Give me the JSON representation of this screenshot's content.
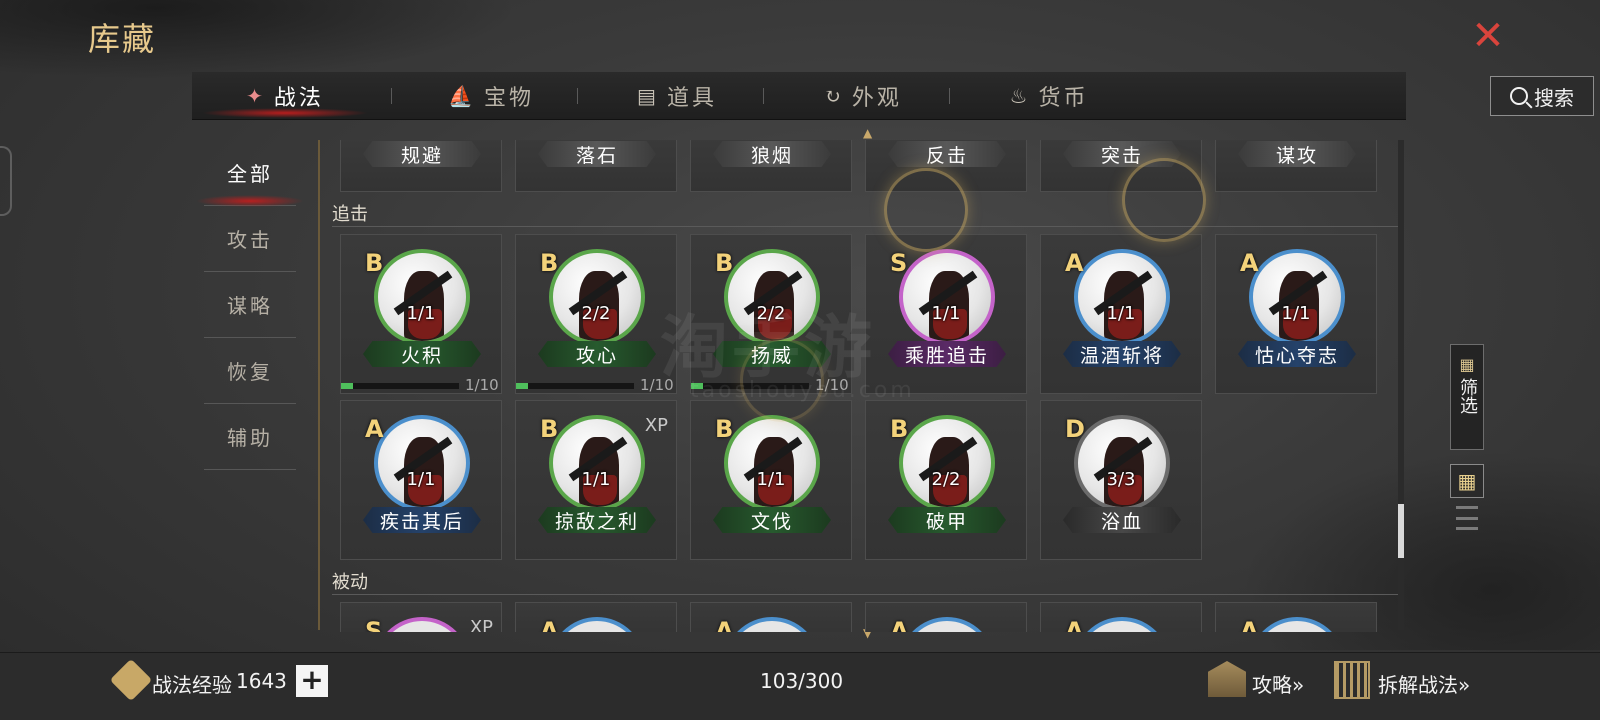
{
  "page_title": "库藏",
  "tabs": [
    {
      "label": "战法",
      "icon": "scroll-bundle-icon",
      "active": true
    },
    {
      "label": "宝物",
      "icon": "treasure-icon",
      "active": false
    },
    {
      "label": "道具",
      "icon": "items-icon",
      "active": false
    },
    {
      "label": "外观",
      "icon": "appearance-icon",
      "active": false
    },
    {
      "label": "货币",
      "icon": "money-bag-icon",
      "active": false
    }
  ],
  "search": {
    "label": "搜索"
  },
  "sidebar": {
    "items": [
      {
        "label": "全部",
        "active": true
      },
      {
        "label": "攻击",
        "active": false
      },
      {
        "label": "谋略",
        "active": false
      },
      {
        "label": "恢复",
        "active": false
      },
      {
        "label": "辅助",
        "active": false
      }
    ]
  },
  "top_row": [
    {
      "name": "规避"
    },
    {
      "name": "落石"
    },
    {
      "name": "狼烟"
    },
    {
      "name": "反击"
    },
    {
      "name": "突击"
    },
    {
      "name": "谋攻"
    }
  ],
  "sections": {
    "pursuit": {
      "title": "追击"
    },
    "passive": {
      "title": "被动"
    }
  },
  "pursuit_cards": [
    {
      "grade": "B",
      "count": "1/1",
      "name": "火积",
      "color": "g",
      "progress": "1/10",
      "progress_value": 0.1
    },
    {
      "grade": "B",
      "count": "2/2",
      "name": "攻心",
      "color": "g",
      "progress": "1/10",
      "progress_value": 0.1
    },
    {
      "grade": "B",
      "count": "2/2",
      "name": "扬威",
      "color": "g",
      "progress": "1/10",
      "progress_value": 0.1
    },
    {
      "grade": "S",
      "count": "1/1",
      "name": "乘胜追击",
      "color": "p"
    },
    {
      "grade": "A",
      "count": "1/1",
      "name": "温酒斩将",
      "color": "b"
    },
    {
      "grade": "A",
      "count": "1/1",
      "name": "怙心夺志",
      "color": "b"
    },
    {
      "grade": "A",
      "count": "1/1",
      "name": "疾击其后",
      "color": "b"
    },
    {
      "grade": "B",
      "count": "1/1",
      "name": "掠敌之利",
      "color": "g",
      "xp": "XP"
    },
    {
      "grade": "B",
      "count": "1/1",
      "name": "文伐",
      "color": "g"
    },
    {
      "grade": "B",
      "count": "2/2",
      "name": "破甲",
      "color": "g"
    },
    {
      "grade": "D",
      "count": "3/3",
      "name": "浴血",
      "color": "d"
    }
  ],
  "passive_cards": [
    {
      "grade": "S",
      "xp": "XP",
      "color": "p"
    },
    {
      "grade": "A",
      "color": "b"
    },
    {
      "grade": "A",
      "color": "b"
    },
    {
      "grade": "A",
      "color": "b"
    },
    {
      "grade": "A",
      "color": "b"
    },
    {
      "grade": "A",
      "color": "b"
    }
  ],
  "watermark": {
    "main": "淘手游",
    "sub": "taoshouyou.com"
  },
  "filter": {
    "label": "筛选"
  },
  "footer": {
    "exp_label": "战法经验",
    "exp_value": "1643",
    "capacity": "103/300",
    "guide": "攻略»",
    "disassemble": "拆解战法»"
  }
}
